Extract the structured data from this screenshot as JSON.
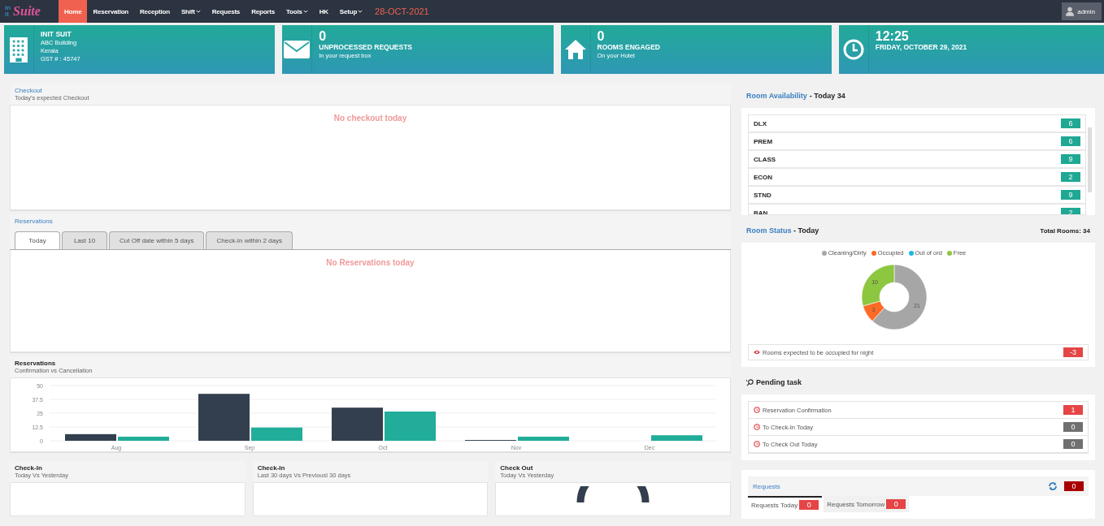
{
  "navbar": {
    "logo": {
      "mark_lines": [
        "in",
        "it"
      ],
      "name": "Suite"
    },
    "menu": [
      {
        "label": "Home",
        "selected": true,
        "dropdown": false
      },
      {
        "label": "Reservation",
        "selected": false,
        "dropdown": false
      },
      {
        "label": "Reception",
        "selected": false,
        "dropdown": false
      },
      {
        "label": "Shift",
        "selected": false,
        "dropdown": true
      },
      {
        "label": "Requests",
        "selected": false,
        "dropdown": false
      },
      {
        "label": "Reports",
        "selected": false,
        "dropdown": false
      },
      {
        "label": "Tools",
        "selected": false,
        "dropdown": true
      },
      {
        "label": "HK",
        "selected": false,
        "dropdown": false
      },
      {
        "label": "Setup",
        "selected": false,
        "dropdown": true
      }
    ],
    "date": "28-OCT-2021",
    "user": "admin"
  },
  "stats": [
    {
      "kind": "building",
      "title": "INIT SUIT",
      "lines": [
        "ABC Building",
        "Kerala",
        "GST # : 45747"
      ]
    },
    {
      "kind": "mail",
      "value": "0",
      "title": "UNPROCESSED REQUESTS",
      "lines": [
        "In your request box"
      ]
    },
    {
      "kind": "home",
      "value": "0",
      "title": "ROOMS ENGAGED",
      "lines": [
        "On your Hotel"
      ]
    },
    {
      "kind": "clock",
      "value": "12:25",
      "title": "FRIDAY, OCTOBER 29, 2021"
    }
  ],
  "checkout": {
    "title": "Checkout",
    "subtitle": "Today's expected Checkout",
    "empty": "No checkout today"
  },
  "reservations": {
    "title": "Reservations",
    "tabs": [
      {
        "label": "Today",
        "selected": true
      },
      {
        "label": "Last 10",
        "selected": false
      },
      {
        "label": "Cut Off date within 5 days",
        "selected": false
      },
      {
        "label": "Check-In within 2 days",
        "selected": false
      }
    ],
    "empty": "No Reservations today"
  },
  "reservation_chart": {
    "title": "Reservations",
    "subtitle": "Confirmation vs Cancellation",
    "chart_data": {
      "type": "bar",
      "categories": [
        "Aug",
        "Sep",
        "Oct",
        "Nov",
        "Dec"
      ],
      "series": [
        {
          "color": "#333f4f",
          "values": [
            6,
            42.5,
            30,
            0.7,
            0
          ]
        },
        {
          "color": "#21ad99",
          "values": [
            3.7,
            12,
            26.5,
            3.7,
            5
          ]
        }
      ],
      "ylim": [
        0,
        50
      ],
      "yticks": [
        0,
        12.5,
        25,
        37.5,
        50
      ],
      "grid": true
    }
  },
  "bottom_panels": [
    {
      "title": "Check-In",
      "subtitle": "Today Vs Yesterday",
      "kind": "blank"
    },
    {
      "title": "Check-In",
      "subtitle": "Last 30 days Vs Previousl 30 days",
      "kind": "blank"
    },
    {
      "title": "Check Out",
      "subtitle": "Today Vs Yesterday",
      "kind": "gauge"
    }
  ],
  "room_availability": {
    "title": "Room Availability",
    "suffix": "- Today 34",
    "rows": [
      {
        "type": "DLX",
        "count": "6"
      },
      {
        "type": "PREM",
        "count": "6"
      },
      {
        "type": "CLASS",
        "count": "9"
      },
      {
        "type": "ECON",
        "count": "2"
      },
      {
        "type": "STND",
        "count": "9"
      },
      {
        "type": "BAN",
        "count": "2"
      }
    ]
  },
  "room_status": {
    "title": "Room Status",
    "suffix": "- Today",
    "total": "Total Rooms: 34",
    "legend": [
      {
        "color": "#a6a6a6"
      },
      {
        "color": "#fc6a25"
      },
      {
        "color": "#1ab7ea"
      },
      {
        "color": "#8dc63f"
      }
    ],
    "chart_data": {
      "type": "donut",
      "categories": [
        "Cleaning/Dirty",
        "Occupied",
        "Out of ord",
        "Free"
      ],
      "values": [
        21,
        3,
        0,
        10
      ],
      "data_labels": true
    },
    "note": "Rooms expected to be occupied for night",
    "note_value": "-3"
  },
  "pending": {
    "title": "Pending task",
    "items": [
      {
        "label": "Reservation Confirmation",
        "count": "1",
        "alert": true
      },
      {
        "label": "To Check-In Today",
        "count": "0",
        "alert": false
      },
      {
        "label": "To Check Out Today",
        "count": "0",
        "alert": false
      }
    ]
  },
  "requests": {
    "title": "Requests",
    "count": "0",
    "tabs": [
      {
        "label": "Requests Today",
        "count": "0",
        "selected": true
      },
      {
        "label": "Requests Tomorrow",
        "count": "0",
        "selected": false
      }
    ]
  }
}
